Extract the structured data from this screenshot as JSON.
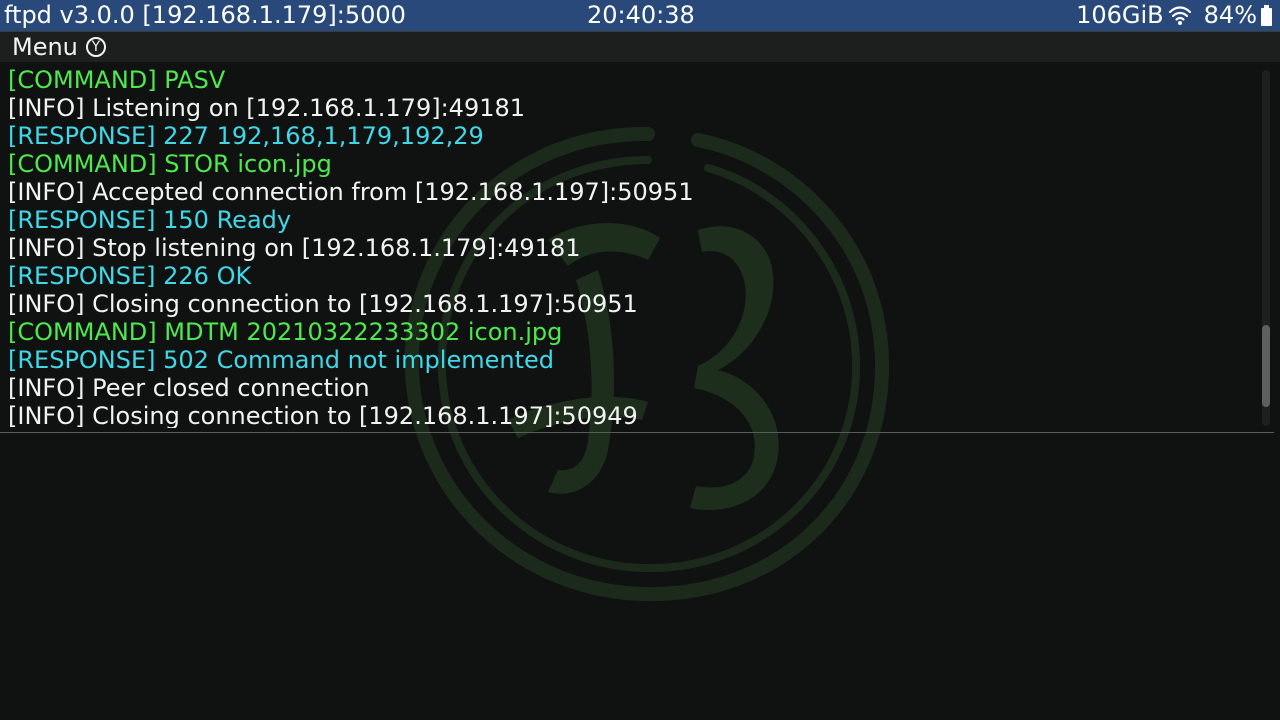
{
  "status": {
    "title": "ftpd v3.0.0 [192.168.1.179]:5000",
    "time": "20:40:38",
    "free_space": "106GiB",
    "battery": "84%",
    "wifi_icon": "wifi-icon",
    "battery_icon": "battery-icon",
    "background_color": "#29497a"
  },
  "menu": {
    "label": "Menu",
    "button_glyph": "Y"
  },
  "colors": {
    "command": "#4fe84f",
    "info": "#f2f2f2",
    "response": "#3fd8e8"
  },
  "log": {
    "scroll_position": 0.93,
    "visible_fraction": 0.23,
    "lines": [
      {
        "type": "command",
        "text": "[COMMAND] PASV"
      },
      {
        "type": "info",
        "text": "[INFO] Listening on [192.168.1.179]:49181"
      },
      {
        "type": "response",
        "text": "[RESPONSE] 227 192,168,1,179,192,29"
      },
      {
        "type": "command",
        "text": "[COMMAND] STOR icon.jpg"
      },
      {
        "type": "info",
        "text": "[INFO] Accepted connection from [192.168.1.197]:50951"
      },
      {
        "type": "response",
        "text": "[RESPONSE] 150 Ready"
      },
      {
        "type": "info",
        "text": "[INFO] Stop listening on [192.168.1.179]:49181"
      },
      {
        "type": "response",
        "text": "[RESPONSE] 226 OK"
      },
      {
        "type": "info",
        "text": "[INFO] Closing connection to [192.168.1.197]:50951"
      },
      {
        "type": "command",
        "text": "[COMMAND] MDTM 20210322233302 icon.jpg"
      },
      {
        "type": "response",
        "text": "[RESPONSE] 502 Command not implemented"
      },
      {
        "type": "info",
        "text": "[INFO] Peer closed connection"
      },
      {
        "type": "info",
        "text": "[INFO] Closing connection to [192.168.1.197]:50949"
      }
    ]
  }
}
